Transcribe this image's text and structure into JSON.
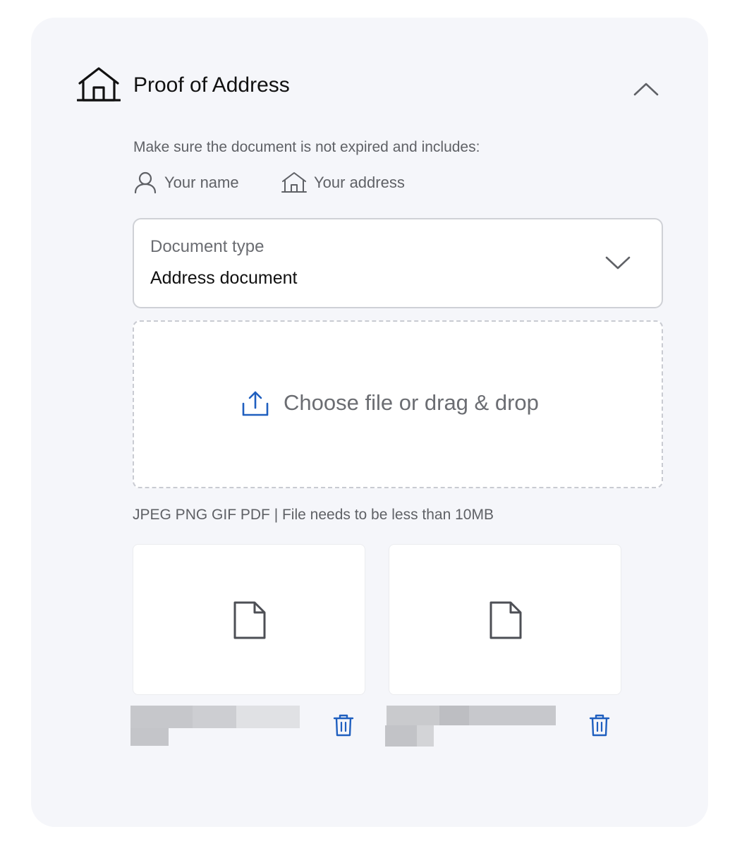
{
  "section": {
    "title": "Proof of Address",
    "header_icon": "house-icon",
    "collapse_icon": "chevron-up-icon"
  },
  "requirements": {
    "hint": "Make sure the document is not expired and includes:",
    "items": [
      {
        "icon": "user-icon",
        "label": "Your name"
      },
      {
        "icon": "house-icon",
        "label": "Your address"
      }
    ]
  },
  "document_type": {
    "label": "Document type",
    "value": "Address document",
    "icon": "chevron-down-icon"
  },
  "upload": {
    "label": "Choose file or drag & drop",
    "icon": "upload-icon",
    "note": "JPEG PNG GIF PDF | File needs to be less than 10MB"
  },
  "files": [
    {
      "icon": "document-icon",
      "delete_icon": "trash-icon"
    },
    {
      "icon": "document-icon",
      "delete_icon": "trash-icon"
    }
  ],
  "colors": {
    "card_background": "#f5f6fa",
    "accent_blue": "#1f5fbf",
    "text_muted": "#5f6166"
  }
}
